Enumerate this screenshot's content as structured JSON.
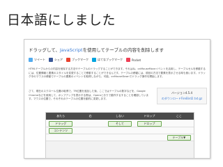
{
  "slide": {
    "title": "日本語にしました"
  },
  "article": {
    "title_prefix": "ドラッグして、",
    "title_keyword": "JavaScript",
    "title_suffix": "を使用してテーブルの内容を削除します",
    "social": [
      {
        "icon": "twitter-icon",
        "label": "ツイート",
        "color": "#55acee"
      },
      {
        "icon": "facebook-icon",
        "label": "シェア",
        "color": "#3b5998"
      },
      {
        "icon": "bookmark-icon",
        "label": "ブックマーク",
        "color": "#e8422f"
      },
      {
        "icon": "hatena-icon",
        "label": "はてなブックマーク",
        "color": "#00a4de"
      },
      {
        "icon": "pocket-icon",
        "label": "Pocket",
        "color": "#ee4056"
      }
    ],
    "paragraph1": "HTMLテーブルからの内容を削除する方法やテーブルのドラッグすることができます。それはね、onMouseMoveイベントを活用し、テーブルセルを移動するには、位置情報と要素のスタイルを変更することで移動することができるんです。テーブルの移動には、前回の方法で要素を表示させる時も使います。ドラッグ中のマウスの移動でテーブルの要素のイベントを取得しながら、可能。onMouseDownでドラッグ操作を開始します。",
    "paragraph2": "さて、現在のスクロール位置の取得で、TR位置を追加した後、ここではテーブルの数字などを、Google Chromeなどを使用して、ポップアップを表示する際は、Operaとおりで動作するすることを確認しています。マウスの位置で、それぞれのテーブルの位置を動的に変更します。",
    "sidebox": {
      "line1": "バージョン4.5.4",
      "line2": "のダウンロードFireBird2.txt.gz"
    }
  },
  "demo": {
    "headers": [
      "あたら",
      "右",
      "しない",
      "ドロップ",
      "ここ"
    ],
    "rows": [
      [
        {
          "col": 0,
          "label": "ドラッグ"
        },
        {
          "col": 2,
          "label": "そして"
        },
        {
          "col": 3,
          "label": "ドロップ"
        }
      ],
      [
        {
          "col": 0,
          "label": "コンテンツ"
        }
      ],
      [
        {
          "col": 4,
          "label": "テーブル▼"
        }
      ]
    ]
  }
}
